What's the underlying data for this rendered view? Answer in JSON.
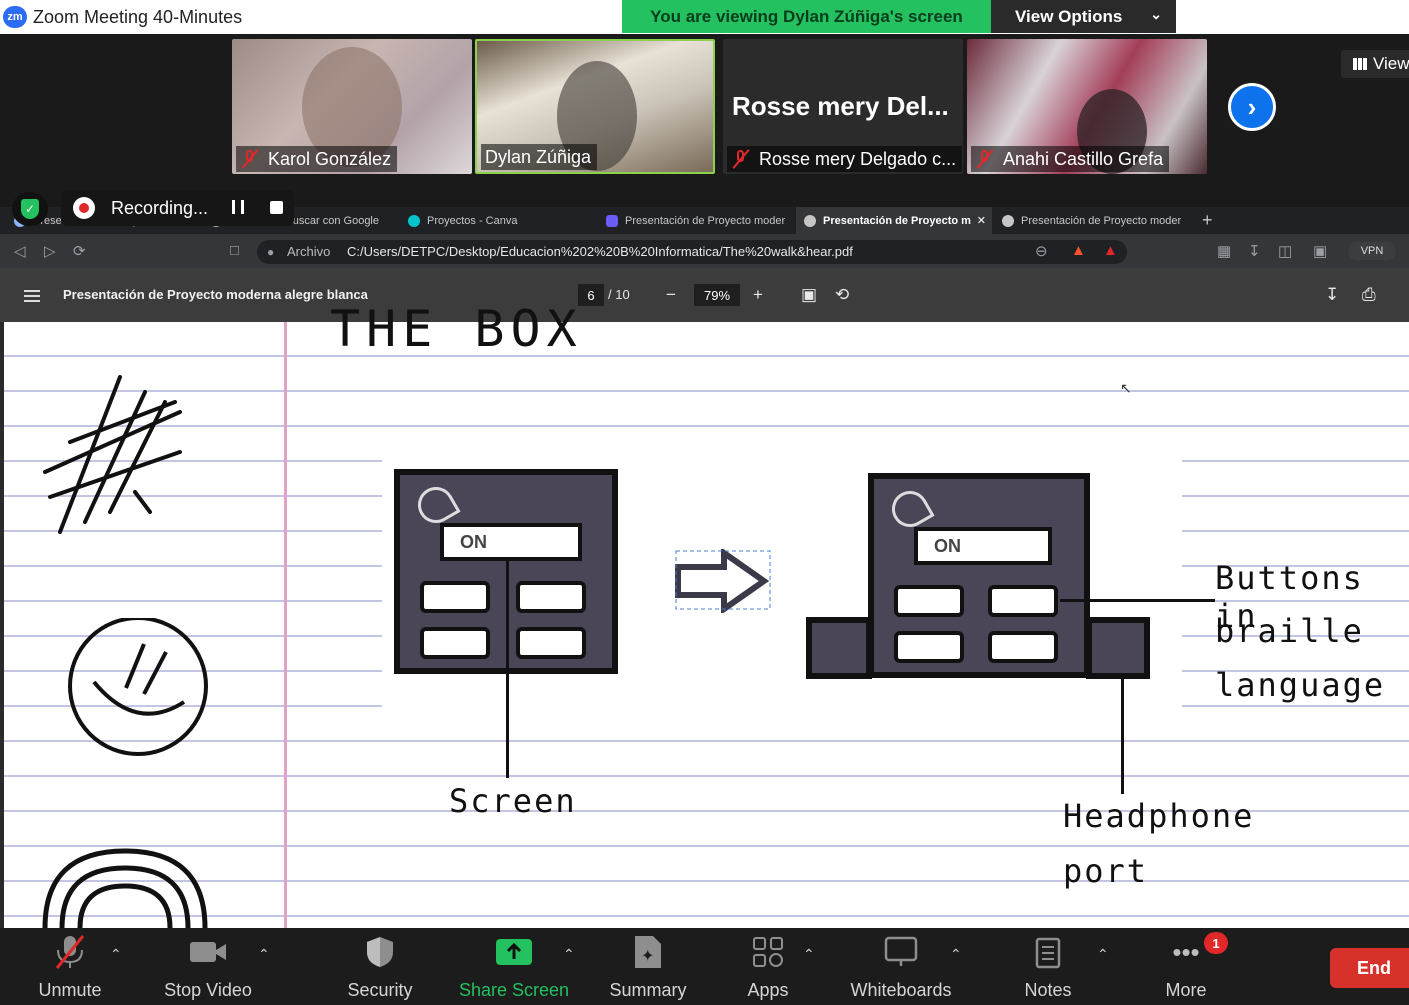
{
  "app": {
    "logo_text": "zm",
    "title": "Zoom Meeting 40-Minutes",
    "viewing_banner": "You are viewing Dylan Zúñiga's screen",
    "view_options": "View Options",
    "view_label": "View"
  },
  "participants": [
    {
      "name": "Karol González",
      "muted": true
    },
    {
      "name": "Dylan Zúñiga",
      "muted": false,
      "active_speaker": true
    },
    {
      "name": "Rosse mery Delgado c...",
      "display_name": "Rosse mery Del...",
      "muted": true,
      "video": false
    },
    {
      "name": "Anahi Castillo Grefa",
      "muted": true
    }
  ],
  "recording": {
    "label": "Recording..."
  },
  "browser": {
    "tabs": [
      {
        "label": "Presentación de Proyecto moder"
      },
      {
        "label": "Traductor - Buscar con Google"
      },
      {
        "label": "Proyectos - Canva"
      },
      {
        "label": "Presentación de Proyecto moder"
      },
      {
        "label": "Presentación de Proyecto m",
        "active": true
      },
      {
        "label": "Presentación de Proyecto moder"
      }
    ],
    "address_prefix": "Archivo",
    "url": "C:/Users/DETPC/Desktop/Educacion%202%20B%20Informatica/The%20walk&hear.pdf",
    "vpn_label": "VPN"
  },
  "pdf_viewer": {
    "doc_title": "Presentación de Proyecto moderna alegre blanca",
    "page_current": "6",
    "page_total": "/ 10",
    "zoom": "79%"
  },
  "slide": {
    "title": "THE BOX",
    "device_on_label": "ON",
    "annotations": {
      "screen": "Screen",
      "buttons_line1": "Buttons in",
      "buttons_line2": "braille",
      "buttons_line3": "language",
      "headphone_line1": "Headphone",
      "headphone_line2": "port"
    }
  },
  "toolbar": {
    "unmute": "Unmute",
    "stop_video": "Stop Video",
    "security": "Security",
    "share_screen": "Share Screen",
    "summary": "Summary",
    "apps": "Apps",
    "whiteboards": "Whiteboards",
    "notes": "Notes",
    "more": "More",
    "more_badge": "1",
    "end": "End"
  },
  "colors": {
    "zoom_blue": "#2d6cf6",
    "banner_green": "#23c160",
    "share_green": "#23c160",
    "end_red": "#d6322b",
    "active_tile_border": "#8bd14b"
  }
}
